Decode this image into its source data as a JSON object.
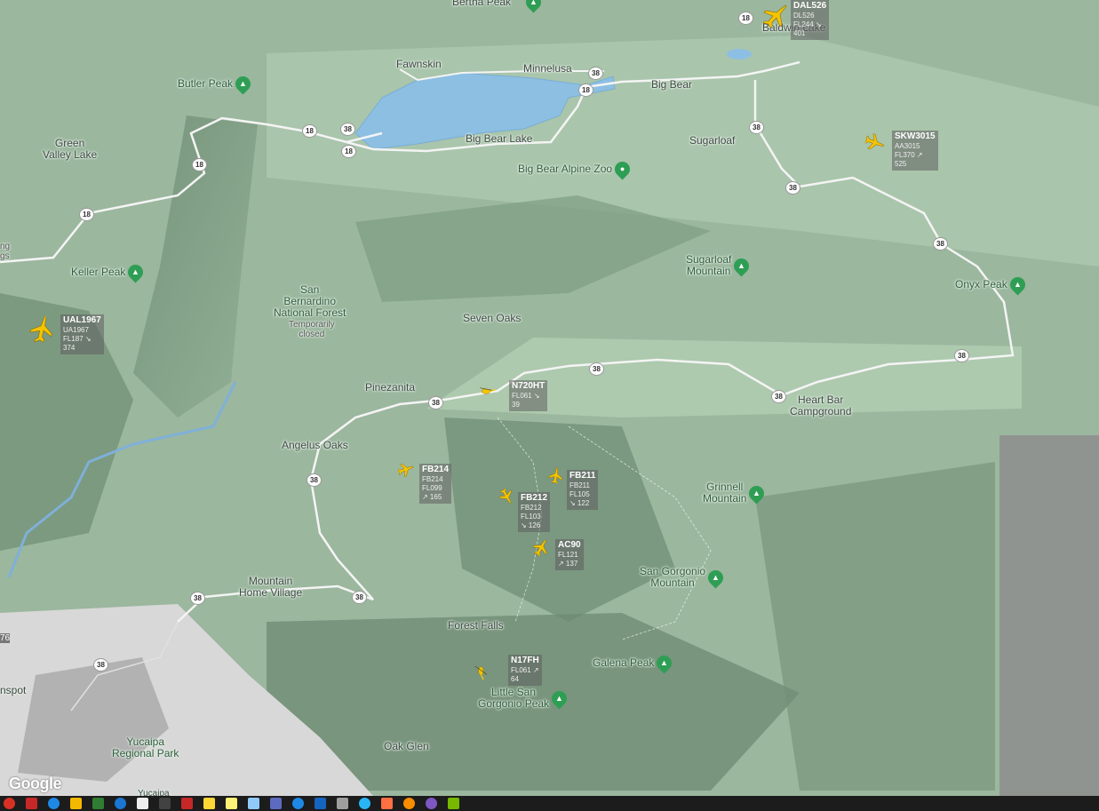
{
  "places": {
    "bertha_peak": "Bertha Peak",
    "fawnskin": "Fawnskin",
    "minnelusa": "Minnelusa",
    "baldwin_lake": "Baldwin Lake",
    "big_bear": "Big Bear",
    "big_bear_lake": "Big Bear Lake",
    "sugarloaf": "Sugarloaf",
    "butler_peak": "Butler Peak",
    "green_valley_lake": "Green\nValley Lake",
    "big_bear_alpine_zoo": "Big Bear Alpine Zoo",
    "keller_peak": "Keller Peak",
    "sbnf": "San\nBernardino\nNational Forest",
    "sbnf_status": "Temporarily\nclosed",
    "sugarloaf_mountain": "Sugarloaf\nMountain",
    "onyx_peak": "Onyx Peak",
    "seven_oaks": "Seven Oaks",
    "pinezanita": "Pinezanita",
    "heart_bar": "Heart Bar\nCampground",
    "angelus_oaks": "Angelus Oaks",
    "grinnell_mountain": "Grinnell\nMountain",
    "san_gorgonio_mountain": "San Gorgonio\nMountain",
    "mountain_home_village": "Mountain\nHome Village",
    "forest_falls": "Forest Falls",
    "galena_peak": "Galena Peak",
    "little_san_gorgonio_peak": "Little San\nGorgonio Peak",
    "yucaipa_regional_park": "Yucaipa\nRegional Park",
    "oak_glen": "Oak Glen",
    "yucaipa": "Yucaipa",
    "edge_left_upper": "ng\ngs",
    "edge_left_lower": "nspot",
    "edge_76": "76"
  },
  "routes": {
    "r18": "18",
    "r38": "38"
  },
  "flights": [
    {
      "callsign": "DAL526",
      "line1": "DL526",
      "line2": "FL244 ↘ 401"
    },
    {
      "callsign": "SKW3015",
      "line1": "AA3015",
      "line2": "FL370 ↗ 525"
    },
    {
      "callsign": "UAL1967",
      "line1": "UA1967",
      "line2": "FL187 ↘ 374"
    },
    {
      "callsign": "N720HT",
      "line1": "FL061 ↘ 39",
      "line2": ""
    },
    {
      "callsign": "FB214",
      "line1": "FB214",
      "line2": "FL099 ↗ 165"
    },
    {
      "callsign": "FB211",
      "line1": "FB211",
      "line2": "FL105 ↘ 122"
    },
    {
      "callsign": "FB212",
      "line1": "FB212",
      "line2": "FL103 ↘ 126"
    },
    {
      "callsign": "AC90",
      "line1": "FL121 ↗ 137",
      "line2": ""
    },
    {
      "callsign": "N17FH",
      "line1": "FL061 ↗ 64",
      "line2": ""
    }
  ],
  "logo": "Google",
  "colors": {
    "terrain": "#9bb79e",
    "lake": "#8dbfe3",
    "road": "#f4f4f4",
    "plane": "#f5c400",
    "poi_green": "#2f9e55"
  }
}
